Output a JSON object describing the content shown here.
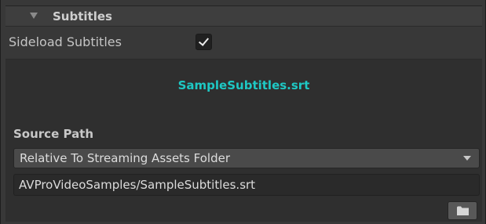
{
  "foldout": {
    "title": "Subtitles",
    "expanded": true,
    "arrow_icon": "foldout-expanded-arrow"
  },
  "sideload": {
    "label": "Sideload Subtitles",
    "checked": true
  },
  "subtitles": {
    "filename": "SampleSubtitles.srt",
    "filename_color": "#1ec8c4"
  },
  "source_path": {
    "label": "Source Path",
    "dropdown_value": "Relative To Streaming Assets Folder",
    "path_value": "AVProVideoSamples/SampleSubtitles.srt",
    "browse_icon": "folder-icon"
  }
}
